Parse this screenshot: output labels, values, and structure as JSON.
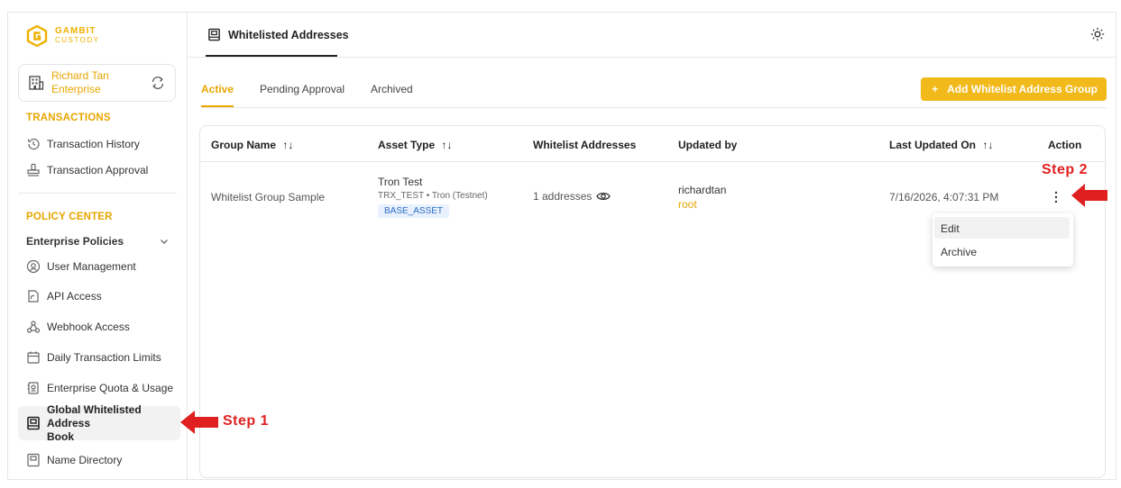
{
  "brand": {
    "line1": "GAMBIT",
    "line2": "CUSTODY",
    "color": "#efb100"
  },
  "enterprise": {
    "line1": "Richard Tan",
    "line2": "Enterprise"
  },
  "sidebar": {
    "transactions_label": "TRANSACTIONS",
    "transaction_history": "Transaction History",
    "transaction_approval": "Transaction Approval",
    "policy_label": "POLICY CENTER",
    "enterprise_policies": "Enterprise Policies",
    "user_management": "User Management",
    "api_access": "API Access",
    "webhook_access": "Webhook Access",
    "daily_limits": "Daily Transaction Limits",
    "quota_usage": "Enterprise Quota & Usage",
    "global_whitelist_l1": "Global Whitelisted Address",
    "global_whitelist_l2": "Book",
    "name_directory": "Name Directory"
  },
  "header": {
    "title": "Whitelisted Addresses"
  },
  "tabs": [
    {
      "label": "Active"
    },
    {
      "label": "Pending Approval"
    },
    {
      "label": "Archived"
    }
  ],
  "add_button": {
    "plus": "+",
    "label": "Add Whitelist Address Group"
  },
  "table": {
    "columns": {
      "group_name": "Group Name",
      "asset_type": "Asset Type",
      "whitelist_addresses": "Whitelist Addresses",
      "updated_by": "Updated by",
      "last_updated_on": "Last Updated On",
      "action": "Action"
    },
    "sort_glyph": "↑↓",
    "rows": [
      {
        "group_name": "Whitelist Group Sample",
        "asset_name": "Tron Test",
        "asset_sub": "TRX_TEST • Tron (Testnet)",
        "asset_badge": "BASE_ASSET",
        "addresses": "1 addresses",
        "updated_by": "richardtan",
        "updated_role": "root",
        "last_updated": "7/16/2026, 4:07:31 PM"
      }
    ]
  },
  "action_menu": {
    "edit": "Edit",
    "archive": "Archive"
  },
  "annotations": {
    "step1": "Step 1",
    "step2": "Step 2",
    "arrow_color": "#e02020"
  },
  "colors": {
    "accent": "#e8a600",
    "button": "#f2b91a",
    "badge_bg": "#e8f1fd",
    "badge_text": "#2d6cc4"
  }
}
